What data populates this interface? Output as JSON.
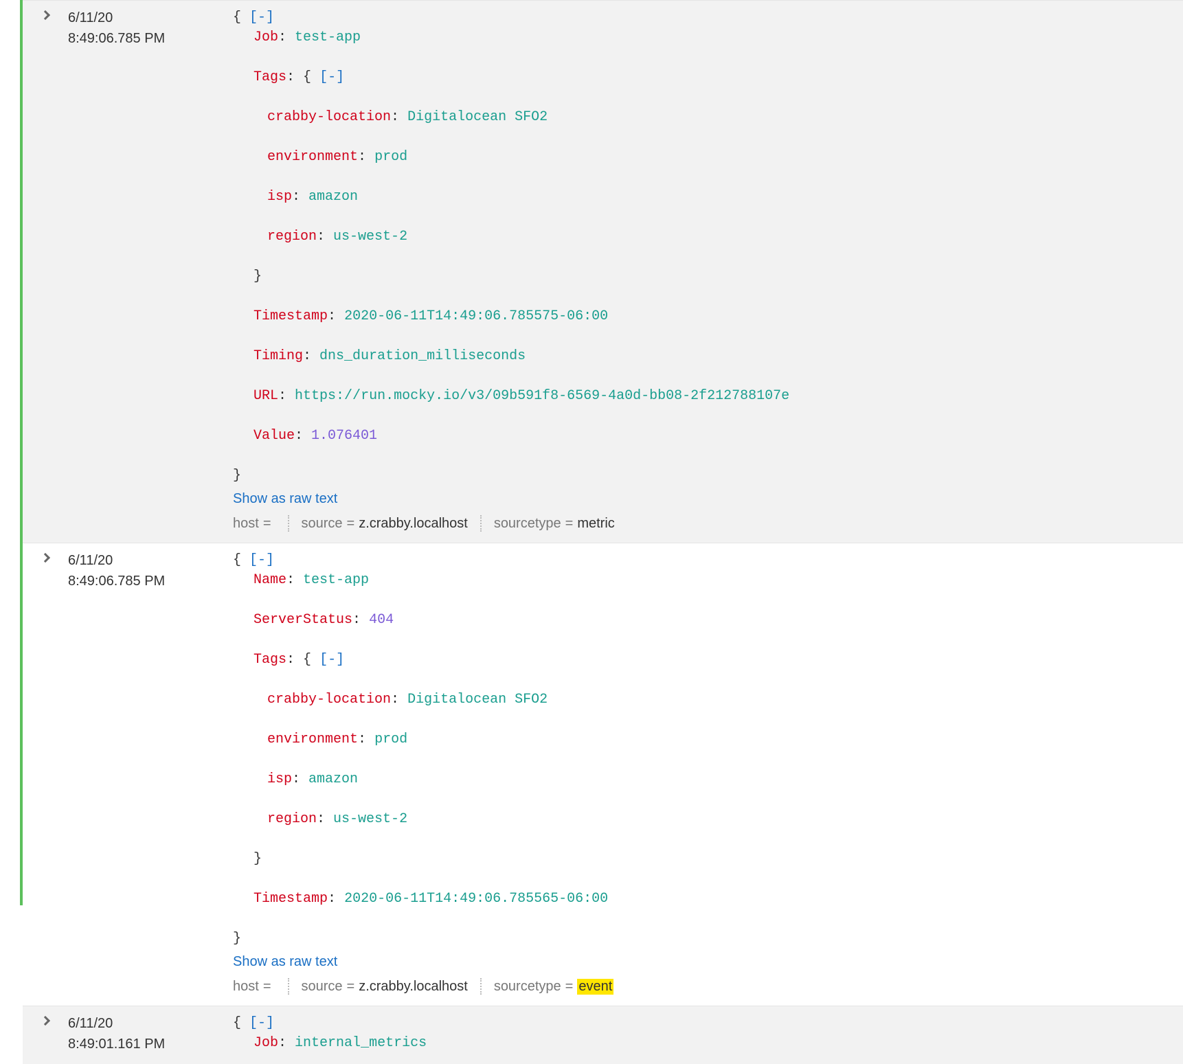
{
  "labels": {
    "show_raw": "Show as raw text",
    "host": "host",
    "source": "source",
    "sourcetype": "sourcetype",
    "collapse": "[-]"
  },
  "events": [
    {
      "alt": true,
      "date": "6/11/20",
      "time": "8:49:06.785 PM",
      "json": {
        "Job": "test-app",
        "Tags": {
          "crabby-location": "Digitalocean SFO2",
          "environment": "prod",
          "isp": "amazon",
          "region": "us-west-2"
        },
        "Timestamp": "2020-06-11T14:49:06.785575-06:00",
        "Timing": "dns_duration_milliseconds",
        "URL": "https://run.mocky.io/v3/09b591f8-6569-4a0d-bb08-2f212788107e",
        "Value": 1.076401
      },
      "meta": {
        "host": "",
        "source": "z.crabby.localhost",
        "sourcetype": "metric",
        "highlight_sourcetype": false
      }
    },
    {
      "alt": false,
      "date": "6/11/20",
      "time": "8:49:06.785 PM",
      "json": {
        "Name": "test-app",
        "ServerStatus": 404,
        "Tags": {
          "crabby-location": "Digitalocean SFO2",
          "environment": "prod",
          "isp": "amazon",
          "region": "us-west-2"
        },
        "Timestamp": "2020-06-11T14:49:06.785565-06:00"
      },
      "meta": {
        "host": "",
        "source": "z.crabby.localhost",
        "sourcetype": "event",
        "highlight_sourcetype": true
      }
    },
    {
      "alt": true,
      "date": "6/11/20",
      "time": "8:49:01.161 PM",
      "json": {
        "Job": "internal_metrics"
      },
      "partial": true
    }
  ]
}
